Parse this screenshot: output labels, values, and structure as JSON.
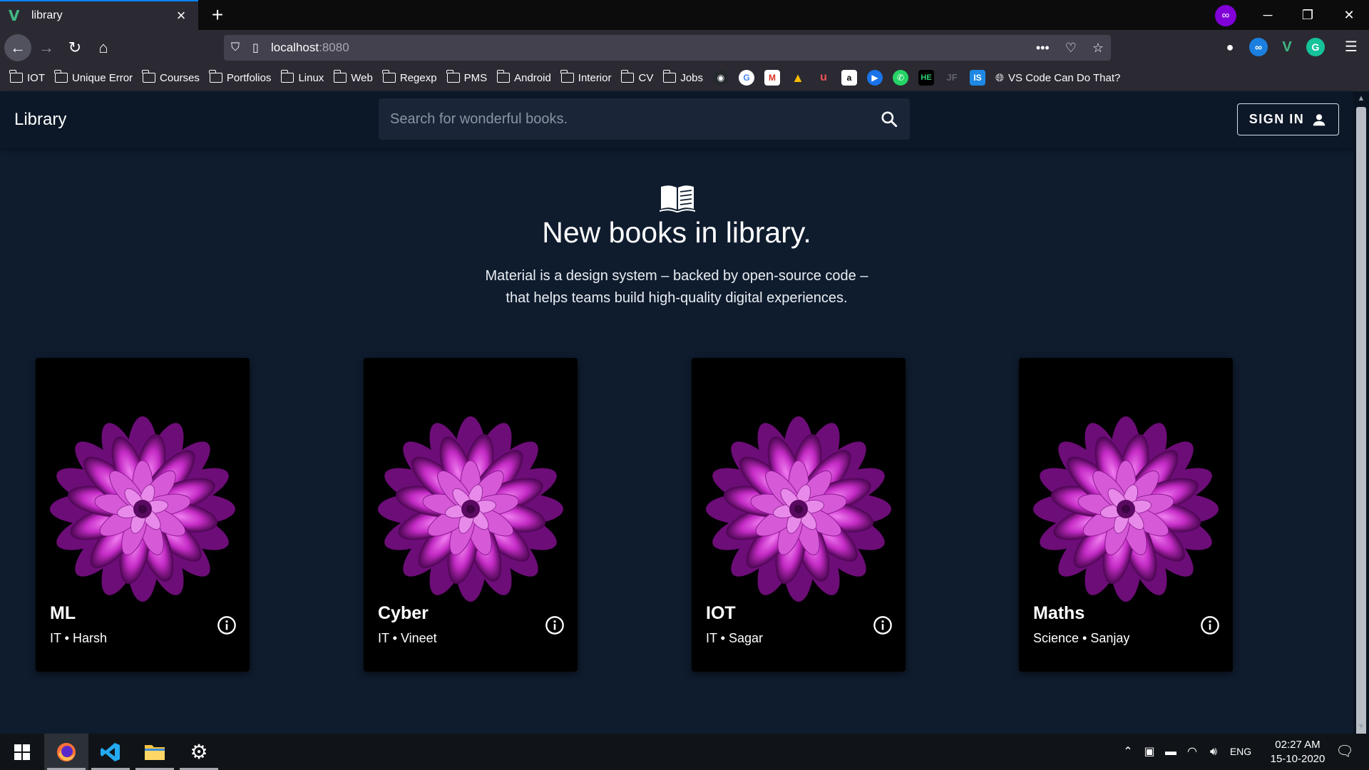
{
  "browser": {
    "tab_title": "library",
    "url_host": "localhost",
    "url_port": ":8080",
    "bookmarks": [
      "IOT",
      "Unique Error",
      "Courses",
      "Portfolios",
      "Linux",
      "Web",
      "Regexp",
      "PMS",
      "Android",
      "Interior",
      "CV",
      "Jobs"
    ],
    "bookmark_last": "VS Code Can Do That?",
    "bookmark_icons": [
      "github-icon",
      "google-icon",
      "gmail-icon",
      "drive-icon",
      "udemy-icon",
      "amazon-icon",
      "play-icon",
      "whatsapp-icon",
      "hackerearth-icon",
      "jf-icon",
      "is-icon"
    ]
  },
  "app": {
    "title": "Library",
    "search_placeholder": "Search for wonderful books.",
    "signin_label": "SIGN IN",
    "hero_title": "New books in library.",
    "hero_line1": "Material is a design system – backed by open-source code –",
    "hero_line2": "that helps teams build high-quality digital experiences."
  },
  "books": [
    {
      "title": "ML",
      "subtitle": "IT • Harsh"
    },
    {
      "title": "Cyber",
      "subtitle": "IT • Vineet"
    },
    {
      "title": "IOT",
      "subtitle": "IT • Sagar"
    },
    {
      "title": "Maths",
      "subtitle": "Science • Sanjay"
    }
  ],
  "taskbar": {
    "language": "ENG",
    "time": "02:27 AM",
    "date": "15-10-2020"
  },
  "colors": {
    "page_bg": "#0f1c2e",
    "header_bg": "#0c1828",
    "card_bg": "#000000",
    "flower": "#b026b5",
    "tab_accent": "#0a84ff"
  }
}
